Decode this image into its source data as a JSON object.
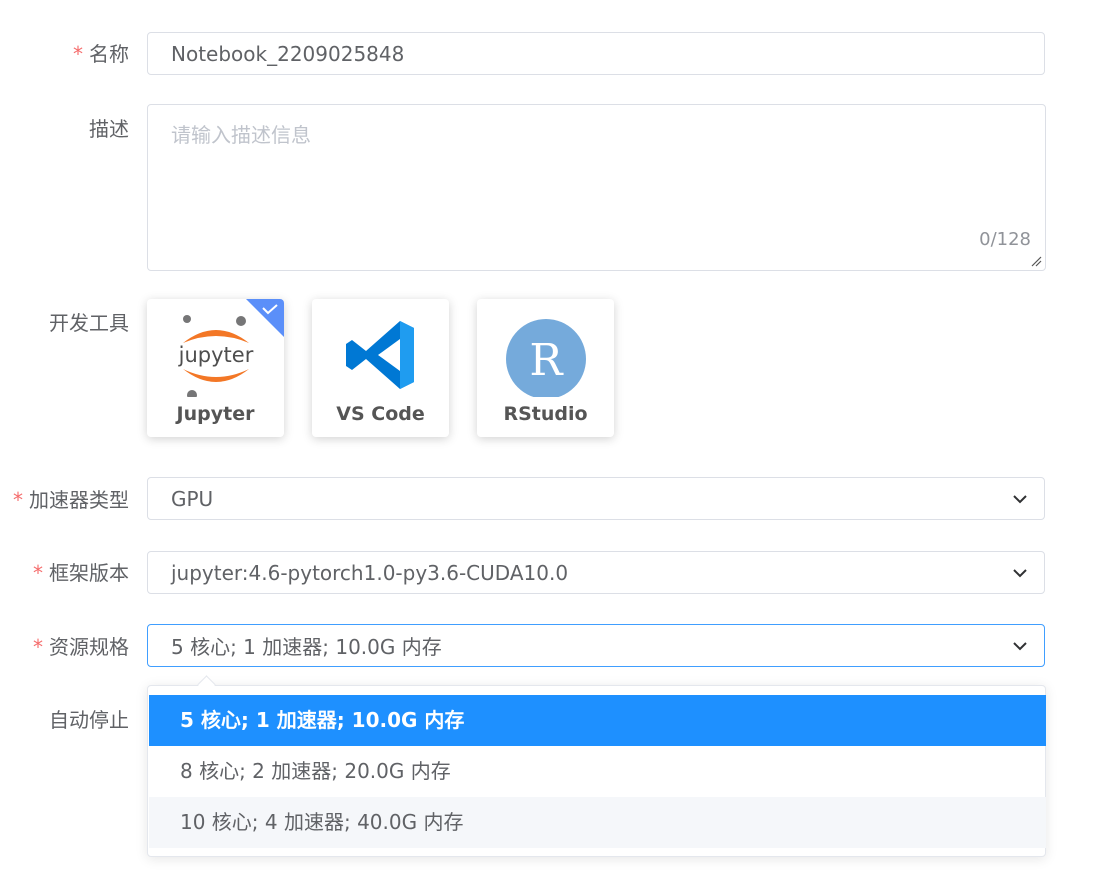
{
  "form": {
    "name": {
      "label": "名称",
      "required_mark": "*",
      "value": "Notebook_2209025848"
    },
    "description": {
      "label": "描述",
      "placeholder": "请输入描述信息",
      "counter": "0/128"
    },
    "dev_tools": {
      "label": "开发工具",
      "options": [
        {
          "name": "Jupyter",
          "logo_text": "jupyter",
          "selected": true
        },
        {
          "name": "VS Code",
          "selected": false
        },
        {
          "name": "RStudio",
          "logo_text": "R",
          "selected": false
        }
      ]
    },
    "accelerator_type": {
      "label": "加速器类型",
      "required_mark": "*",
      "value": "GPU"
    },
    "framework_version": {
      "label": "框架版本",
      "required_mark": "*",
      "value": "jupyter:4.6-pytorch1.0-py3.6-CUDA10.0"
    },
    "resource_spec": {
      "label": "资源规格",
      "required_mark": "*",
      "value": "5 核心; 1 加速器; 10.0G 内存",
      "options": [
        "5 核心; 1 加速器; 10.0G 内存",
        "8 核心; 2 加速器; 20.0G 内存",
        "10 核心; 4 加速器; 40.0G 内存"
      ]
    },
    "auto_stop": {
      "label": "自动停止"
    }
  },
  "colors": {
    "accent": "#409eff",
    "selected_option": "#1e90ff",
    "required": "#f56c6c",
    "jupyter_orange": "#e46e2e",
    "vscode_blue": "#0078d4",
    "rstudio_blue": "#75aadb"
  }
}
